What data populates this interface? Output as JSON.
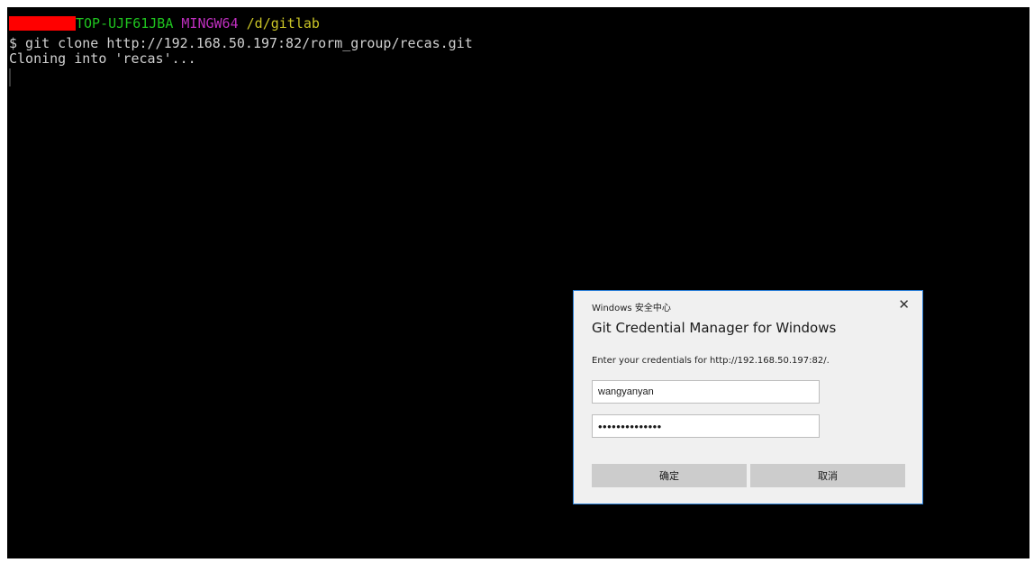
{
  "terminal": {
    "prompt": {
      "host": "TOP-UJF61JBA",
      "system": "MINGW64",
      "path": "/d/gitlab"
    },
    "command_line": "$ git clone http://192.168.50.197:82/rorm_group/recas.git",
    "output_line": "Cloning into 'recas'..."
  },
  "dialog": {
    "caption": "Windows 安全中心",
    "close_glyph": "✕",
    "title": "Git Credential Manager for Windows",
    "message": "Enter your credentials for http://192.168.50.197:82/.",
    "username_value": "wangyanyan",
    "password_value": "••••••••••••••",
    "ok_label": "确定",
    "cancel_label": "取消"
  },
  "colors": {
    "terminal_bg": "#000000",
    "host": "#1fc31f",
    "system": "#bd2fbd",
    "path": "#c9c326",
    "redaction": "#ff0000",
    "dialog_border": "#2b7fd6",
    "dialog_bg": "#f0f0f0",
    "button_bg": "#cccccc"
  }
}
